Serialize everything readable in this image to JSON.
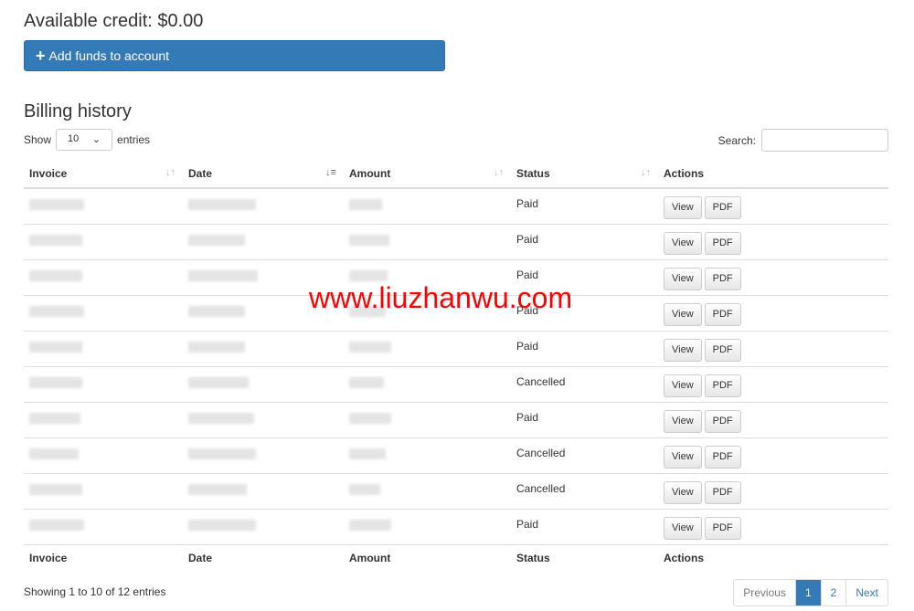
{
  "credit": "Available credit: $0.00",
  "add_funds": "Add funds to account",
  "billing_title": "Billing history",
  "show": "Show",
  "entries": "entries",
  "page_size": "10",
  "search_label": "Search:",
  "search_value": "",
  "columns": [
    "Invoice",
    "Date",
    "Amount",
    "Status",
    "Actions"
  ],
  "rows": [
    {
      "status": "Paid"
    },
    {
      "status": "Paid"
    },
    {
      "status": "Paid"
    },
    {
      "status": "Paid"
    },
    {
      "status": "Paid"
    },
    {
      "status": "Cancelled"
    },
    {
      "status": "Paid"
    },
    {
      "status": "Cancelled"
    },
    {
      "status": "Cancelled"
    },
    {
      "status": "Paid"
    }
  ],
  "view": "View",
  "pdf": "PDF",
  "info": "Showing 1 to 10 of 12 entries",
  "pager": {
    "prev": "Previous",
    "p1": "1",
    "p2": "2",
    "next": "Next"
  },
  "watermark": "www.liuzhanwu.com",
  "accent": "#337ab7"
}
